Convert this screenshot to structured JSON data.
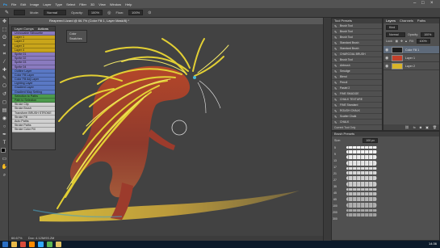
{
  "app": {
    "logo": "Ps",
    "menu": [
      "File",
      "Edit",
      "Image",
      "Layer",
      "Type",
      "Select",
      "Filter",
      "3D",
      "View",
      "Window",
      "Help"
    ],
    "window_controls": [
      "–",
      "□",
      "×"
    ]
  },
  "options_bar": {
    "mode_label": "Mode:",
    "mode_value": "Normal",
    "opacity_label": "Opacity:",
    "opacity_value": "100%",
    "flow_label": "Flow:",
    "flow_value": "100%"
  },
  "document": {
    "tab_title": "Reapered Lizard @ 66.7% (Color Fill 1, Layer Mask/8) *",
    "zoom": "66.67%",
    "doc_info": "Doc: 4.12M/93.2M"
  },
  "layer_comps_panel": {
    "tabs": [
      "Layer Comps",
      "Actions"
    ],
    "items": [
      {
        "label": "Unmovable Silhouette",
        "color": "#8a7bbf"
      },
      {
        "label": "Layer 1",
        "color": "#c9a51a"
      },
      {
        "label": "Layer 2",
        "color": "#c9a51a"
      },
      {
        "label": "Layer 3",
        "color": "#c9a51a"
      },
      {
        "label": "Layer 4",
        "color": "#c9a51a"
      },
      {
        "label": "Sprite 01",
        "color": "#8a7bbf"
      },
      {
        "label": "Sprite 02",
        "color": "#8a7bbf"
      },
      {
        "label": "Sprite 03",
        "color": "#8a7bbf"
      },
      {
        "label": "Sprite 04",
        "color": "#8a7bbf"
      },
      {
        "label": "Outline Layer",
        "color": "#5a78c4"
      },
      {
        "label": "Color Fill Layer",
        "color": "#5a78c4"
      },
      {
        "label": "Color Fill Adj Layer",
        "color": "#5a78c4"
      },
      {
        "label": "Lighting Layer",
        "color": "#5a78c4"
      },
      {
        "label": "Gradient Layer",
        "color": "#5a78c4"
      },
      {
        "label": "Gradient Map Setting",
        "color": "#5a78c4"
      },
      {
        "label": "Selection to Paths",
        "color": "#4c9a4c"
      },
      {
        "label": "Path to Selection",
        "color": "#4c9a4c"
      },
      {
        "label": "Stroke Clip",
        "color": "#d0d0d0"
      },
      {
        "label": "Stroke Brush",
        "color": "#d0d0d0"
      },
      {
        "label": "Transform BRUSH STROKE",
        "color": "#d0d0d0"
      },
      {
        "label": "Stroke Fill",
        "color": "#d0d0d0"
      },
      {
        "label": "Auto Paths",
        "color": "#d0d0d0"
      },
      {
        "label": "Stroke Paths",
        "color": "#d0d0d0"
      },
      {
        "label": "Stroke Color Fill",
        "color": "#d0d0d0"
      }
    ]
  },
  "floating_panel": {
    "items": [
      "Color",
      "Swatches"
    ]
  },
  "history_panel": {
    "title": "Tool Presets",
    "items": [
      "Brush Tool",
      "Brush Tool",
      "Brush Tool",
      "Standard Brush",
      "Standard Brush",
      "CHARCOAL BRUSH",
      "Brush Tool",
      "Airbrush",
      "Smudge",
      "Blend",
      "Pencil",
      "Pastel 2",
      "FINE SMUDGE",
      "CHALK TEXTURE",
      "FINE Standard",
      "ROUGH CHALK",
      "Scatter Chalk",
      "CHALK",
      "CHARCOAL BRUSH",
      "Gouache Brush",
      "COLOUR BRUSH",
      "COLOUR BRUSH Small",
      "COLOUR BRUSH Smudge"
    ],
    "footer": "Current Tool Only"
  },
  "layers_panel": {
    "tabs": [
      "Layers",
      "Channels",
      "Paths"
    ],
    "kind": "Kind",
    "blend_mode": "Normal",
    "opacity_label": "Opacity:",
    "opacity_value": "100%",
    "lock_label": "Lock:",
    "fill_label": "Fill:",
    "fill_value": "100%",
    "layers": [
      {
        "name": "Color Fill 1",
        "thumb": "#1c1c1c"
      },
      {
        "name": "Layer 1",
        "thumb": "#c2402a"
      },
      {
        "name": "Layer 2",
        "thumb": "#d9b42a"
      }
    ]
  },
  "brush_presets": {
    "title": "Brush Presets",
    "size_label": "Size:",
    "size_value": "100 px",
    "sizes": [
      "5",
      "9",
      "13",
      "17",
      "21",
      "27",
      "35",
      "45",
      "65",
      "100",
      "200",
      "300"
    ],
    "stroke_count": 14
  },
  "taskbar": {
    "icons": [
      {
        "name": "windows-start-icon",
        "color": "#2b6fc4"
      },
      {
        "name": "explorer-icon",
        "color": "#e8b949"
      },
      {
        "name": "browser-icon",
        "color": "#d84b3b"
      },
      {
        "name": "media-icon",
        "color": "#ff8a00"
      },
      {
        "name": "photoshop-icon",
        "color": "#31a8ff"
      },
      {
        "name": "chrome-icon",
        "color": "#5ab552"
      },
      {
        "name": "folder-icon",
        "color": "#e0c060"
      }
    ],
    "clock": "14:36"
  },
  "colors": {
    "foreground": "#000000",
    "background": "#ffffff"
  }
}
